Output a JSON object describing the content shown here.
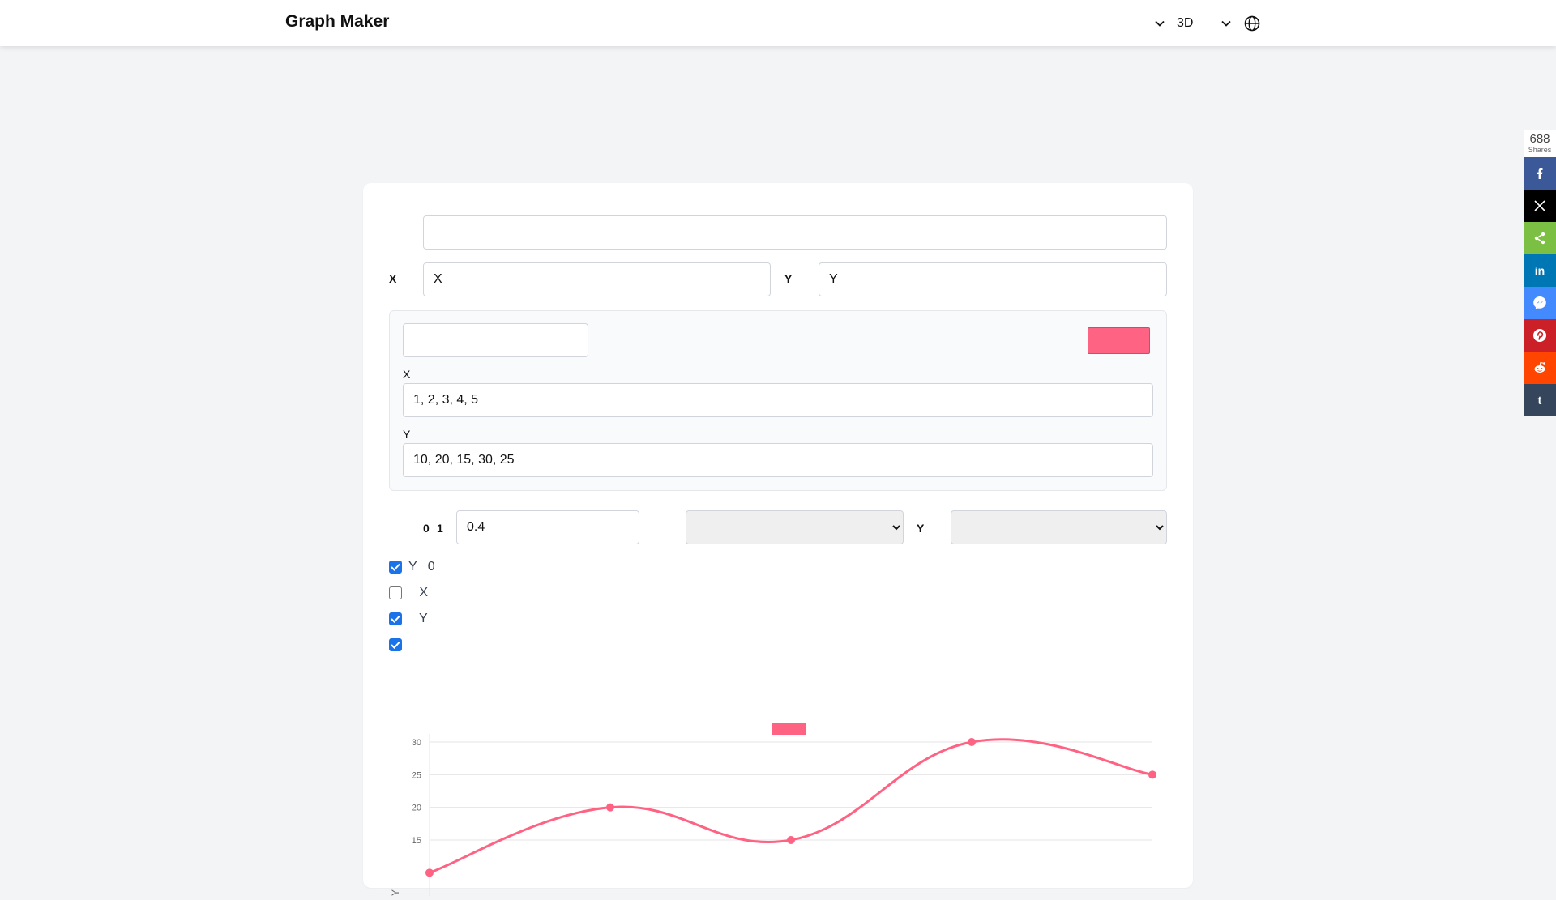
{
  "header": {
    "brand": "Graph Maker",
    "menu_label": "3D"
  },
  "form": {
    "title_value": "",
    "x_axis_label": "X",
    "x_axis_value": "X",
    "y_axis_label": "Y",
    "y_axis_value": "Y",
    "dataset": {
      "name_value": "",
      "color": "#ff6384",
      "x_label": "X",
      "x_value": "1, 2, 3, 4, 5",
      "y_label": "Y",
      "y_value": "10, 20, 15, 30, 25"
    },
    "tension_label_min": "0",
    "tension_label_max": "1",
    "tension_value": "0.4",
    "select1_value": "",
    "select2_label": "Y",
    "select2_value": ""
  },
  "checkboxes": [
    {
      "text": "Y   0",
      "checked": true
    },
    {
      "text": "   X",
      "checked": false
    },
    {
      "text": "   Y",
      "checked": true
    },
    {
      "text": "",
      "checked": true
    }
  ],
  "chart_data": {
    "type": "line",
    "x": [
      1,
      2,
      3,
      4,
      5
    ],
    "series": [
      {
        "values": [
          10,
          20,
          15,
          30,
          25
        ],
        "color": "#ff6384"
      }
    ],
    "ylabel": "Y",
    "y_ticks": [
      "15",
      "20",
      "25",
      "30"
    ],
    "ylim": [
      10,
      30
    ],
    "grid": true,
    "legend": "top"
  },
  "share": {
    "count": "688",
    "count_label": "Shares",
    "buttons": [
      {
        "icon": "facebook-icon",
        "color": "#3b5998"
      },
      {
        "icon": "x-icon",
        "color": "#000000"
      },
      {
        "icon": "share-icon",
        "color": "#7bc043"
      },
      {
        "icon": "linkedin-icon",
        "color": "#0077b5"
      },
      {
        "icon": "messenger-icon",
        "color": "#448aff"
      },
      {
        "icon": "pinterest-icon",
        "color": "#cb2027"
      },
      {
        "icon": "reddit-icon",
        "color": "#ff4500"
      },
      {
        "icon": "tumblr-icon",
        "color": "#35465c"
      }
    ]
  }
}
